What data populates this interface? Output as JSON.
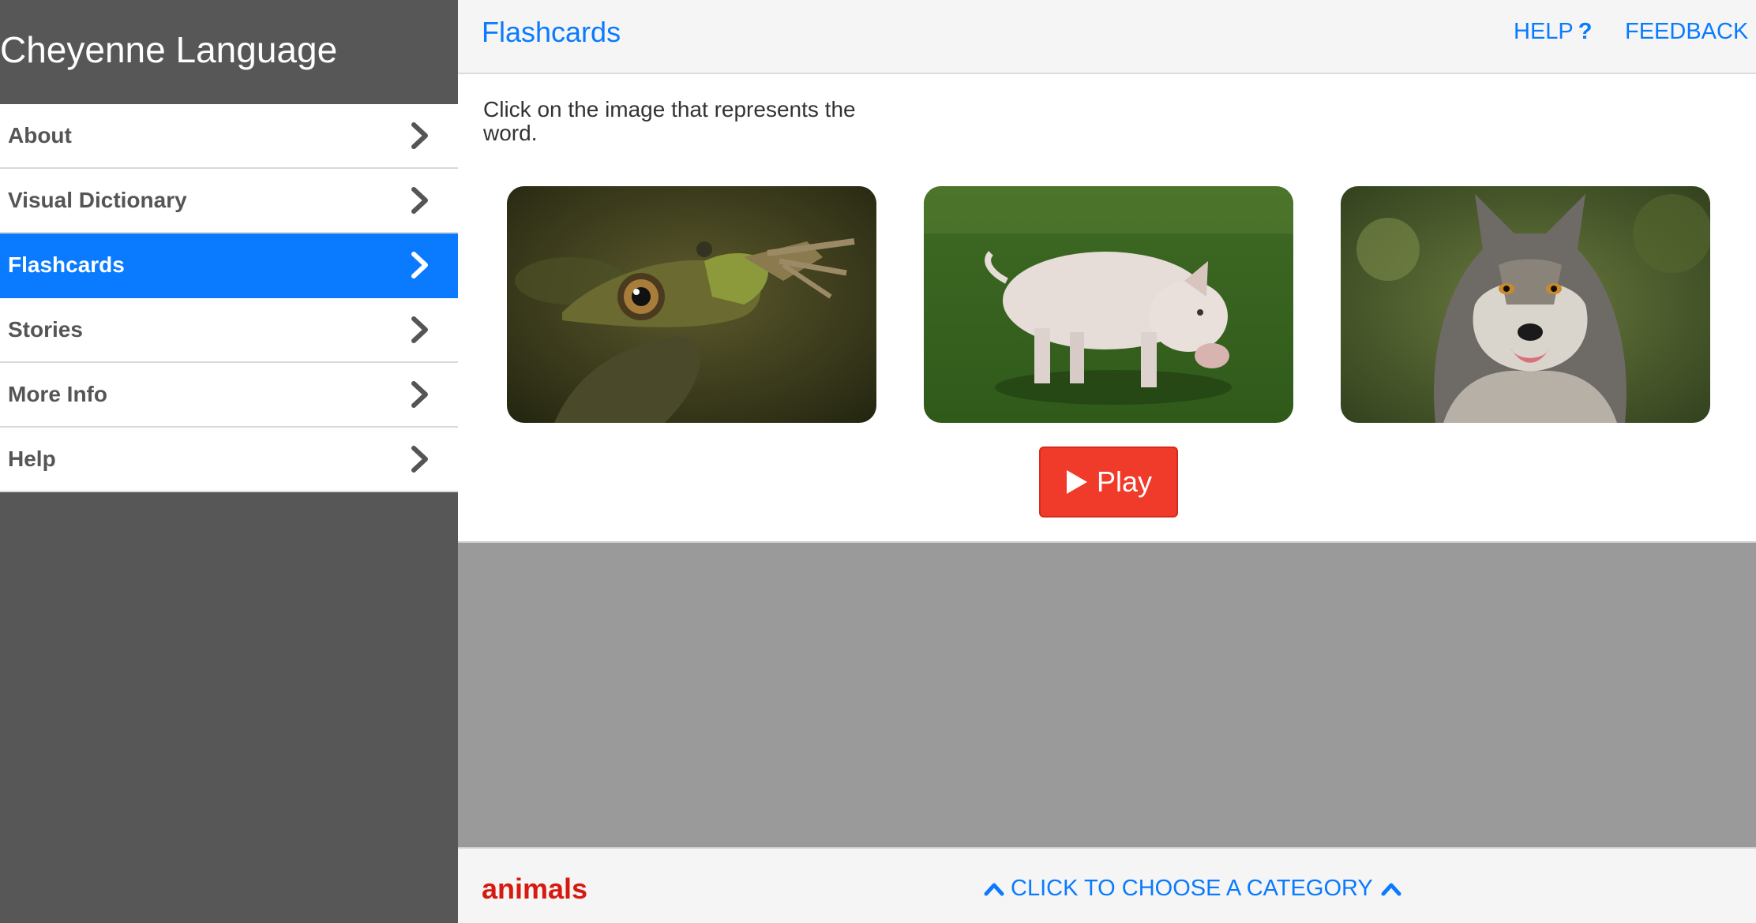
{
  "app": {
    "title": "Cheyenne Language"
  },
  "sidebar": {
    "items": [
      {
        "label": "About",
        "active": false
      },
      {
        "label": "Visual Dictionary",
        "active": false
      },
      {
        "label": "Flashcards",
        "active": true
      },
      {
        "label": "Stories",
        "active": false
      },
      {
        "label": "More Info",
        "active": false
      },
      {
        "label": "Help",
        "active": false
      }
    ]
  },
  "header": {
    "title": "Flashcards",
    "help_label": "HELP",
    "help_icon": "?",
    "feedback_label": "FEEDBACK"
  },
  "main": {
    "instructions": "Click on the image that represents the word.",
    "images": [
      {
        "name": "frog-image"
      },
      {
        "name": "pig-image"
      },
      {
        "name": "wolf-image"
      }
    ],
    "play_label": "Play"
  },
  "footer": {
    "category": "animals",
    "choose_label": "CLICK TO CHOOSE A CATEGORY"
  },
  "colors": {
    "accent": "#0a7aff",
    "play": "#f03a2a",
    "category": "#d61a0f",
    "sidebar_bg": "#575757"
  }
}
